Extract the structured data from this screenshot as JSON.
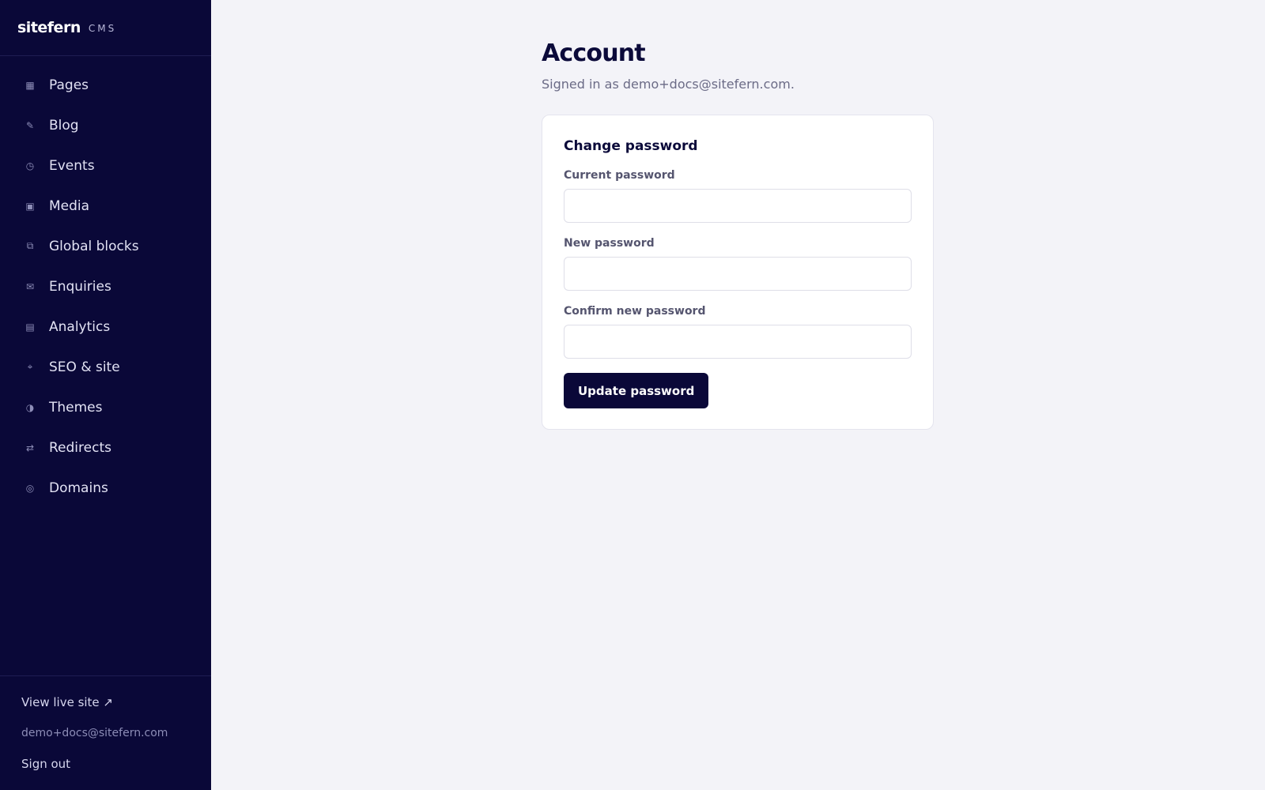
{
  "brand": {
    "name": "sitefern",
    "tag": "CMS"
  },
  "sidebar": {
    "items": [
      {
        "label": "Pages",
        "icon": "▦",
        "icon_name": "pages-icon"
      },
      {
        "label": "Blog",
        "icon": "✎",
        "icon_name": "pencil-icon"
      },
      {
        "label": "Events",
        "icon": "◷",
        "icon_name": "clock-icon"
      },
      {
        "label": "Media",
        "icon": "▣",
        "icon_name": "image-icon"
      },
      {
        "label": "Global blocks",
        "icon": "⧉",
        "icon_name": "blocks-icon"
      },
      {
        "label": "Enquiries",
        "icon": "✉",
        "icon_name": "mail-icon"
      },
      {
        "label": "Analytics",
        "icon": "▤",
        "icon_name": "chart-icon"
      },
      {
        "label": "SEO & site",
        "icon": "⌖",
        "icon_name": "target-icon"
      },
      {
        "label": "Themes",
        "icon": "◑",
        "icon_name": "theme-icon"
      },
      {
        "label": "Redirects",
        "icon": "⇄",
        "icon_name": "redirect-icon"
      },
      {
        "label": "Domains",
        "icon": "◎",
        "icon_name": "globe-icon"
      }
    ],
    "footer": {
      "live_link": "View live site ↗",
      "email": "demo+docs@sitefern.com",
      "sign_out": "Sign out"
    }
  },
  "main": {
    "title": "Account",
    "subtitle": "Signed in as demo+docs@sitefern.com.",
    "card": {
      "title": "Change password",
      "fields": [
        {
          "label": "Current password",
          "value": ""
        },
        {
          "label": "New password",
          "value": ""
        },
        {
          "label": "Confirm new password",
          "value": ""
        }
      ],
      "submit_label": "Update password"
    }
  },
  "colors": {
    "sidebar_bg": "#0a0838",
    "page_bg": "#f3f3f8",
    "primary": "#0a0838",
    "card_bg": "#ffffff"
  }
}
